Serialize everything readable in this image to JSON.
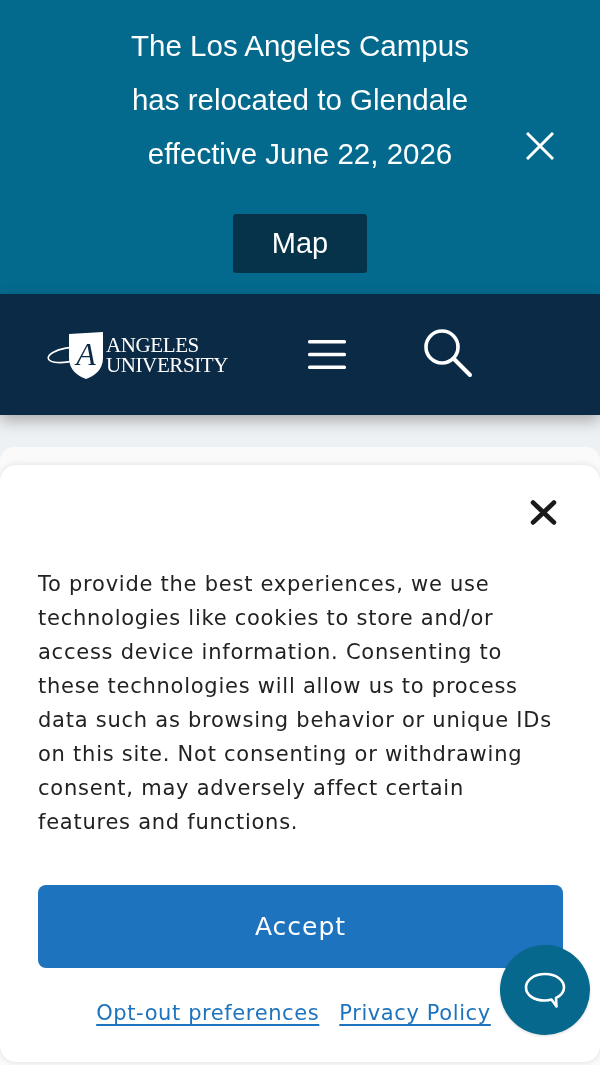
{
  "announcement_bar": {
    "message": "The Los Angeles Campus has relocated to Glendale effective June 22, 2026",
    "button": "Map"
  },
  "site_header": {
    "logo_letter": "A",
    "wordmark": "ANGELES UNIVERSITY"
  },
  "cookie_banner": {
    "message": "To provide the best experiences, we use technologies like cookies to store and/or access device information. Consenting to these technologies will allow us to process data such as browsing behavior or unique IDs on this site. Not consenting or withdrawing consent, may adversely affect certain features and functions.",
    "accept_button": "Accept",
    "links": [
      "Opt-out preferences",
      "Privacy Policy"
    ]
  }
}
